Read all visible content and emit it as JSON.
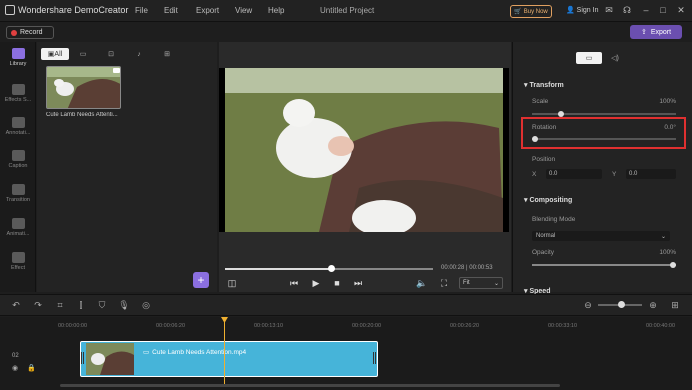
{
  "app": {
    "name": "Wondershare DemoCreator",
    "menu": [
      "File",
      "Edit",
      "Export",
      "View",
      "Help"
    ],
    "project_title": "Untitled Project",
    "buy_now": "Buy Now",
    "sign_in": "Sign In"
  },
  "toolbar": {
    "record_label": "Record",
    "export_label": "Export"
  },
  "left_nav": [
    {
      "label": "Library",
      "icon": "folder-icon",
      "active": true
    },
    {
      "label": "Effects S...",
      "icon": "effects-icon",
      "active": false
    },
    {
      "label": "Annotati...",
      "icon": "annotation-icon",
      "active": false
    },
    {
      "label": "Caption",
      "icon": "caption-icon",
      "active": false
    },
    {
      "label": "Transition",
      "icon": "transition-icon",
      "active": false
    },
    {
      "label": "Animati...",
      "icon": "animation-icon",
      "active": false
    },
    {
      "label": "Effect",
      "icon": "wand-icon",
      "active": false
    }
  ],
  "media": {
    "tabs": [
      "All",
      "video",
      "image",
      "audio",
      "other"
    ],
    "item_label": "Cute Lamb Needs Attenti..."
  },
  "player": {
    "timecode": "00:00:28 | 00:00:53",
    "progress": 0.51,
    "fit_label": "Fit"
  },
  "properties": {
    "tabs": [
      "video",
      "audio"
    ],
    "transform_title": "Transform",
    "scale_label": "Scale",
    "scale_value": "100%",
    "rotation_label": "Rotation",
    "rotation_value": "0.0°",
    "position_label": "Position",
    "x_label": "X",
    "x_value": "0.0",
    "y_label": "Y",
    "y_value": "0.0",
    "compositing_title": "Compositing",
    "blending_label": "Blending Mode",
    "blending_value": "Normal",
    "opacity_label": "Opacity",
    "opacity_value": "100%",
    "speed_title": "Speed"
  },
  "timeline": {
    "ticks": [
      "00:00:00:00",
      "00:00:06:20",
      "00:00:13:10",
      "00:00:20:00",
      "00:00:26:20",
      "00:00:33:10",
      "00:00:40:00"
    ],
    "track_number": "02",
    "clip_label": "Cute Lamb Needs Attention.mp4"
  },
  "colors": {
    "accent": "#8b6fe0",
    "clip": "#46b4d9",
    "playhead": "#f0b030",
    "highlight": "#e03030"
  }
}
